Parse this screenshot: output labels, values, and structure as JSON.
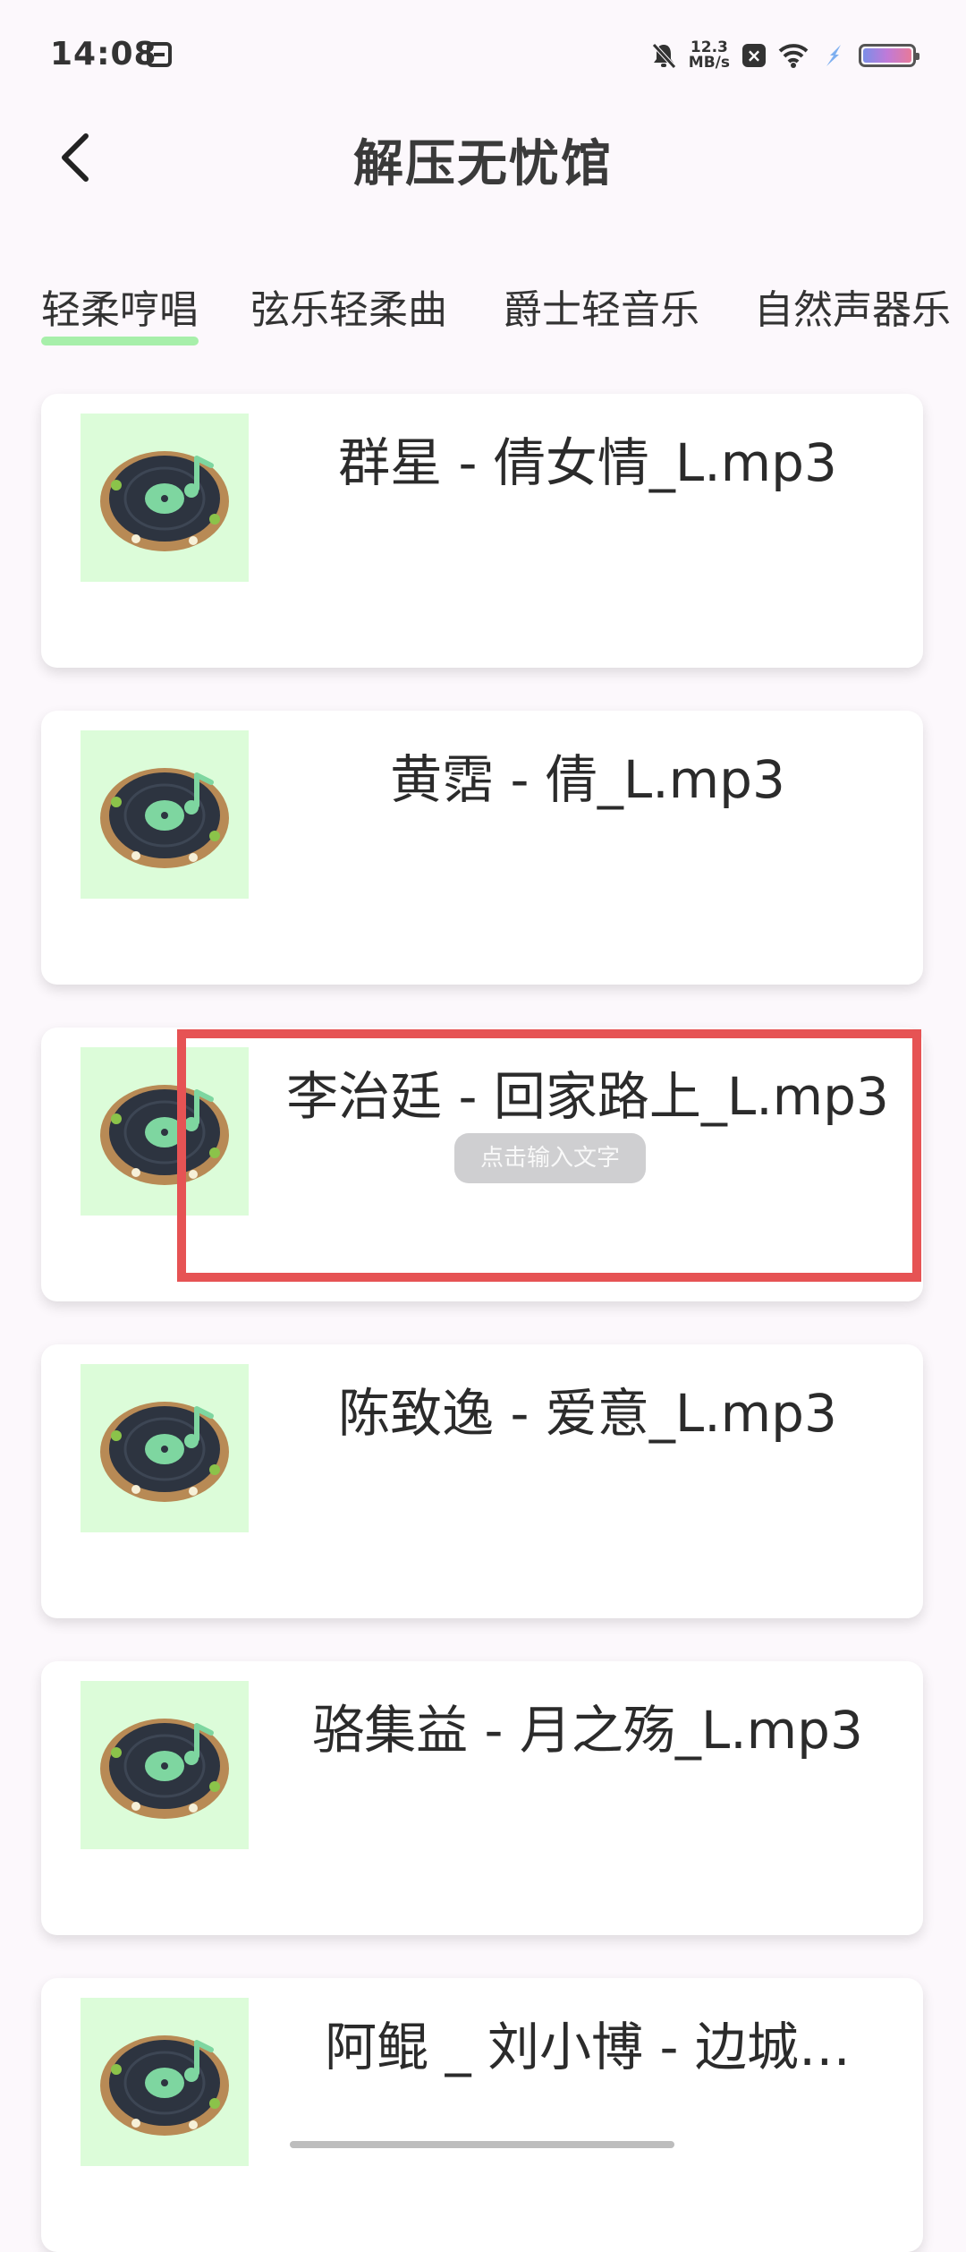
{
  "status_bar": {
    "time": "14:08",
    "net_speed_value": "12.3",
    "net_speed_unit": "MB/s"
  },
  "header": {
    "title": "解压无忧馆"
  },
  "tabs": [
    {
      "label": "轻柔哼唱",
      "active": true
    },
    {
      "label": "弦乐轻柔曲",
      "active": false
    },
    {
      "label": "爵士轻音乐",
      "active": false
    },
    {
      "label": "自然声器乐",
      "active": false
    }
  ],
  "songs": [
    {
      "title": "群星 - 倩女情_L.mp3"
    },
    {
      "title": "黄霑 - 倩_L.mp3"
    },
    {
      "title": "李治廷 - 回家路上_L.mp3"
    },
    {
      "title": "陈致逸 - 爱意_L.mp3"
    },
    {
      "title": "骆集益 - 月之殇_L.mp3"
    },
    {
      "title": "阿鲲 _ 刘小博 - 边城…"
    }
  ],
  "overlay": {
    "hint_text": "点击输入文字"
  },
  "colors": {
    "tab_underline": "#a7efaa",
    "thumb_background": "#dcfcd9",
    "annotation_red": "#e65354"
  }
}
